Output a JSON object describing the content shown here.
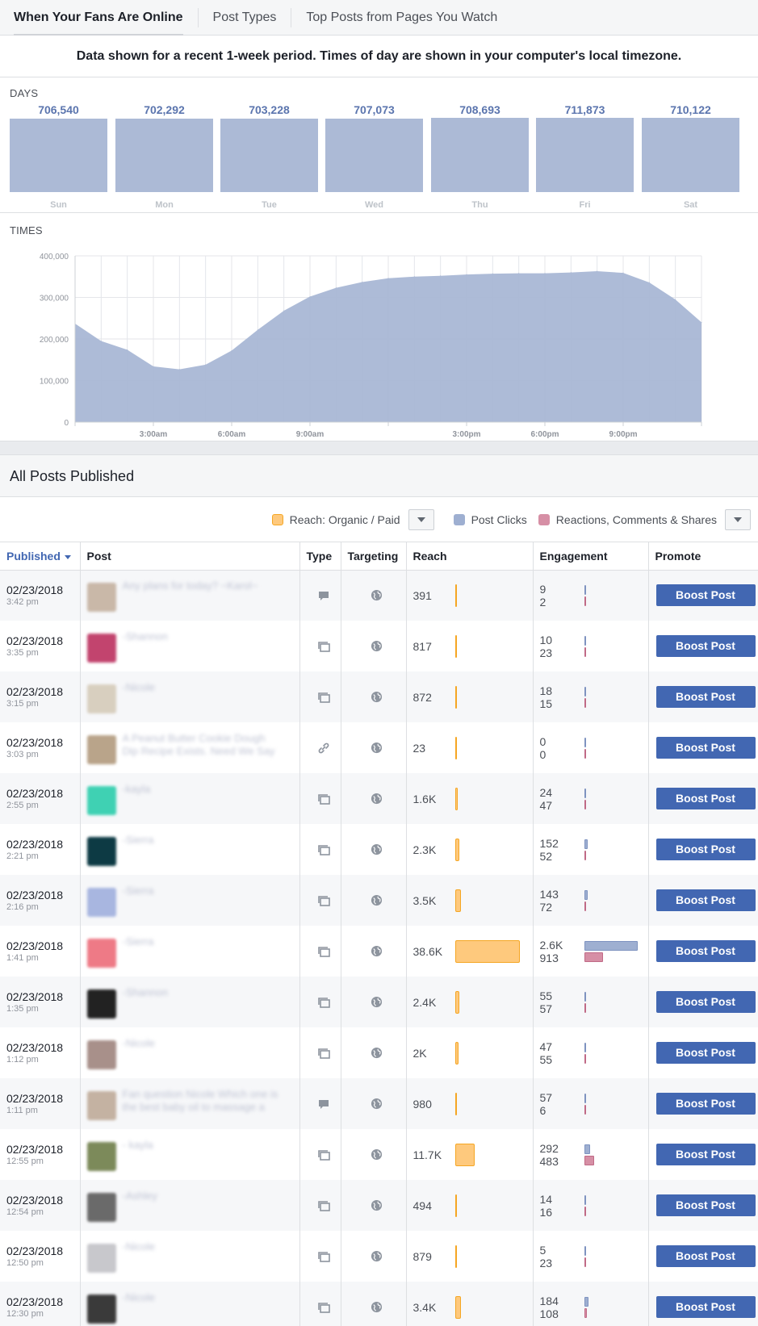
{
  "tabs": [
    "When Your Fans Are Online",
    "Post Types",
    "Top Posts from Pages You Watch"
  ],
  "notice": "Data shown for a recent 1-week period. Times of day are shown in your computer's local timezone.",
  "days_label": "DAYS",
  "times_label": "TIMES",
  "chart_data": [
    {
      "type": "bar",
      "categories": [
        "Sun",
        "Mon",
        "Tue",
        "Wed",
        "Thu",
        "Fri",
        "Sat"
      ],
      "values": [
        706540,
        702292,
        703228,
        707073,
        708693,
        711873,
        710122
      ],
      "value_labels": [
        "706,540",
        "702,292",
        "703,228",
        "707,073",
        "708,693",
        "711,873",
        "710,122"
      ]
    },
    {
      "type": "area",
      "x": [
        0,
        1,
        2,
        3,
        4,
        5,
        6,
        7,
        8,
        9,
        10,
        11,
        12,
        13,
        14,
        15,
        16,
        17,
        18,
        19,
        20,
        21,
        22,
        23,
        24
      ],
      "values": [
        237000,
        195000,
        174000,
        134000,
        127000,
        138000,
        172000,
        222000,
        268000,
        302000,
        323000,
        337000,
        346000,
        350000,
        352000,
        355000,
        357000,
        358000,
        358000,
        360000,
        363000,
        359000,
        336000,
        295000,
        240000
      ],
      "yticks": [
        "0",
        "100,000",
        "200,000",
        "300,000",
        "400,000"
      ],
      "ylim": [
        0,
        400000
      ],
      "xticks": [
        {
          "hour": 3,
          "label": "3:00am"
        },
        {
          "hour": 6,
          "label": "6:00am"
        },
        {
          "hour": 9,
          "label": "9:00am"
        },
        {
          "hour": 15,
          "label": "3:00pm"
        },
        {
          "hour": 18,
          "label": "6:00pm"
        },
        {
          "hour": 21,
          "label": "9:00pm"
        }
      ],
      "grid": true
    }
  ],
  "posts_title": "All Posts Published",
  "legend": {
    "reach": "Reach: Organic / Paid",
    "clicks": "Post Clicks",
    "reactions": "Reactions, Comments & Shares",
    "colors": {
      "reach": "#fec97d",
      "clicks": "#9eafd1",
      "reactions": "#d68fa5"
    }
  },
  "columns": [
    "Published",
    "Post",
    "Type",
    "Targeting",
    "Reach",
    "Engagement",
    "Promote"
  ],
  "boost_label": "Boost Post",
  "rows": [
    {
      "date": "02/23/2018",
      "time": "3:42 pm",
      "text": "Any plans for today? ~Karol~",
      "thumb": "#c9b8a8",
      "type": "status",
      "reach": "391",
      "reach_value": 391,
      "clicks": "9",
      "clicks_value": 9,
      "reactions": "2",
      "reactions_value": 2
    },
    {
      "date": "02/23/2018",
      "time": "3:35 pm",
      "text": "-Shannon",
      "thumb": "#c2446e",
      "type": "photo",
      "reach": "817",
      "reach_value": 817,
      "clicks": "10",
      "clicks_value": 10,
      "reactions": "23",
      "reactions_value": 23
    },
    {
      "date": "02/23/2018",
      "time": "3:15 pm",
      "text": "-Nicole",
      "thumb": "#d8cfbf",
      "type": "photo",
      "reach": "872",
      "reach_value": 872,
      "clicks": "18",
      "clicks_value": 18,
      "reactions": "15",
      "reactions_value": 15
    },
    {
      "date": "02/23/2018",
      "time": "3:03 pm",
      "text": "A Peanut Butter Cookie Dough Dip Recipe Exists. Need We Say More",
      "thumb": "#b9a48a",
      "type": "link",
      "reach": "23",
      "reach_value": 23,
      "clicks": "0",
      "clicks_value": 0,
      "reactions": "0",
      "reactions_value": 0
    },
    {
      "date": "02/23/2018",
      "time": "2:55 pm",
      "text": "-kayla",
      "thumb": "#3fd1b3",
      "type": "photo",
      "reach": "1.6K",
      "reach_value": 1600,
      "clicks": "24",
      "clicks_value": 24,
      "reactions": "47",
      "reactions_value": 47
    },
    {
      "date": "02/23/2018",
      "time": "2:21 pm",
      "text": "-Sierra",
      "thumb": "#0d3a44",
      "type": "photo",
      "reach": "2.3K",
      "reach_value": 2300,
      "clicks": "152",
      "clicks_value": 152,
      "reactions": "52",
      "reactions_value": 52
    },
    {
      "date": "02/23/2018",
      "time": "2:16 pm",
      "text": "-Sierra",
      "thumb": "#a8b6e0",
      "type": "photo",
      "reach": "3.5K",
      "reach_value": 3500,
      "clicks": "143",
      "clicks_value": 143,
      "reactions": "72",
      "reactions_value": 72
    },
    {
      "date": "02/23/2018",
      "time": "1:41 pm",
      "text": "-Sierra",
      "thumb": "#ee7a86",
      "type": "photo",
      "reach": "38.6K",
      "reach_value": 38600,
      "clicks": "2.6K",
      "clicks_value": 2600,
      "reactions": "913",
      "reactions_value": 913
    },
    {
      "date": "02/23/2018",
      "time": "1:35 pm",
      "text": "-Shannon",
      "thumb": "#222222",
      "type": "photo",
      "reach": "2.4K",
      "reach_value": 2400,
      "clicks": "55",
      "clicks_value": 55,
      "reactions": "57",
      "reactions_value": 57
    },
    {
      "date": "02/23/2018",
      "time": "1:12 pm",
      "text": "-Nicole",
      "thumb": "#a8908a",
      "type": "photo",
      "reach": "2K",
      "reach_value": 2000,
      "clicks": "47",
      "clicks_value": 47,
      "reactions": "55",
      "reactions_value": 55
    },
    {
      "date": "02/23/2018",
      "time": "1:11 pm",
      "text": "Fan question Nicole Which one is the best baby oil to massage a newborn",
      "thumb": "#c4b2a2",
      "type": "status",
      "reach": "980",
      "reach_value": 980,
      "clicks": "57",
      "clicks_value": 57,
      "reactions": "6",
      "reactions_value": 6
    },
    {
      "date": "02/23/2018",
      "time": "12:55 pm",
      "text": "- kayla",
      "thumb": "#7c8a5a",
      "type": "photo",
      "reach": "11.7K",
      "reach_value": 11700,
      "clicks": "292",
      "clicks_value": 292,
      "reactions": "483",
      "reactions_value": 483
    },
    {
      "date": "02/23/2018",
      "time": "12:54 pm",
      "text": "-Ashley",
      "thumb": "#6a6a6a",
      "type": "photo",
      "reach": "494",
      "reach_value": 494,
      "clicks": "14",
      "clicks_value": 14,
      "reactions": "16",
      "reactions_value": 16
    },
    {
      "date": "02/23/2018",
      "time": "12:50 pm",
      "text": "-Nicole",
      "thumb": "#c8c8cc",
      "type": "photo",
      "reach": "879",
      "reach_value": 879,
      "clicks": "5",
      "clicks_value": 5,
      "reactions": "23",
      "reactions_value": 23
    },
    {
      "date": "02/23/2018",
      "time": "12:30 pm",
      "text": "-Nicole",
      "thumb": "#3a3a3a",
      "type": "photo",
      "reach": "3.4K",
      "reach_value": 3400,
      "clicks": "184",
      "clicks_value": 184,
      "reactions": "108",
      "reactions_value": 108
    }
  ]
}
